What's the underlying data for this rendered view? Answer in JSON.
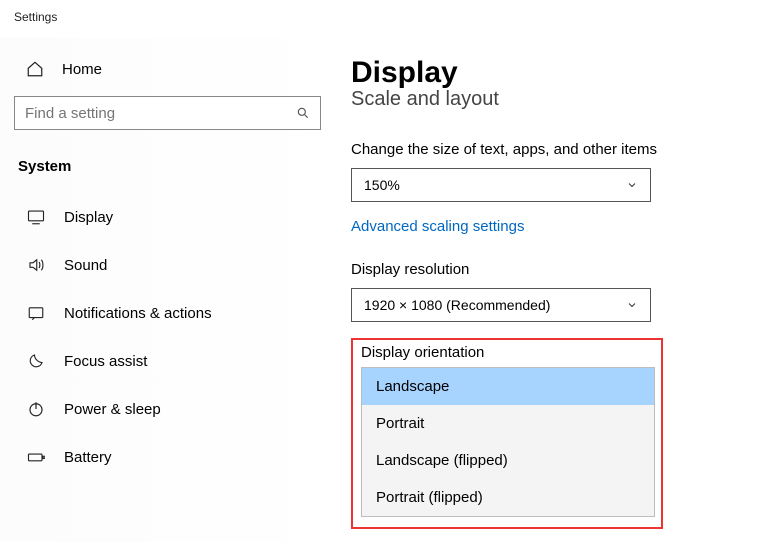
{
  "window": {
    "title": "Settings"
  },
  "sidebar": {
    "home_label": "Home",
    "search_placeholder": "Find a setting",
    "category": "System",
    "items": [
      {
        "label": "Display"
      },
      {
        "label": "Sound"
      },
      {
        "label": "Notifications & actions"
      },
      {
        "label": "Focus assist"
      },
      {
        "label": "Power & sleep"
      },
      {
        "label": "Battery"
      }
    ]
  },
  "main": {
    "title": "Display",
    "section": "Scale and layout",
    "scale": {
      "label": "Change the size of text, apps, and other items",
      "value": "150%"
    },
    "advanced_link": "Advanced scaling settings",
    "resolution": {
      "label": "Display resolution",
      "value": "1920 × 1080 (Recommended)"
    },
    "orientation": {
      "label": "Display orientation",
      "options": [
        "Landscape",
        "Portrait",
        "Landscape (flipped)",
        "Portrait (flipped)"
      ],
      "selected": "Landscape"
    }
  }
}
